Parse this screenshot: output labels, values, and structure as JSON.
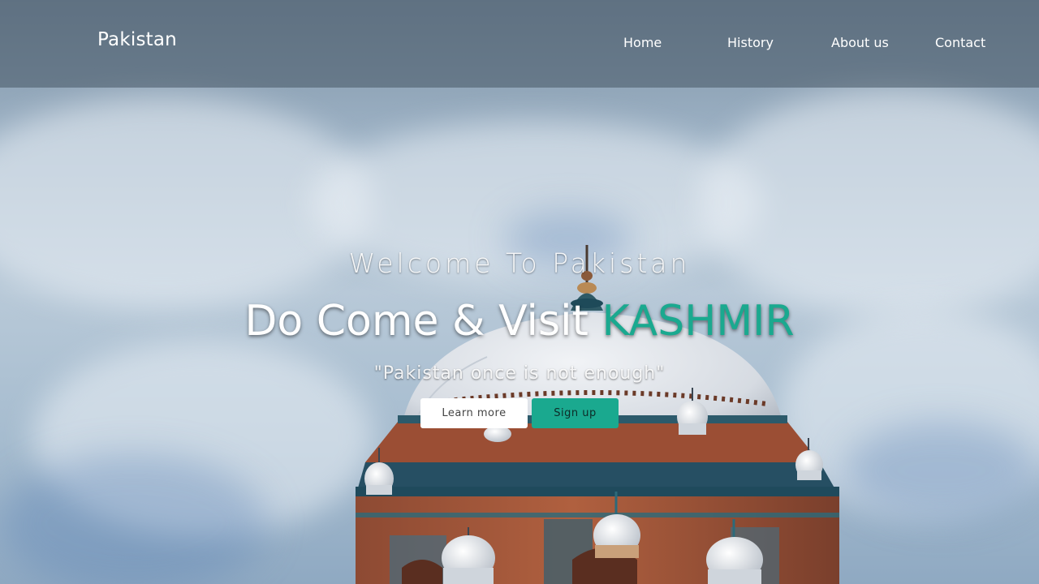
{
  "navbar": {
    "brand": "Pakistan",
    "links": [
      {
        "label": "Home"
      },
      {
        "label": "History"
      },
      {
        "label": "About us"
      },
      {
        "label": "Contact"
      }
    ]
  },
  "hero": {
    "subtitle": "Welcome To Pakistan",
    "title_prefix": "Do Come & Visit ",
    "title_accent": "KASHMIR",
    "quote": "\"Pakistan once is not enough\"",
    "learn_more_label": "Learn more",
    "sign_up_label": "Sign up"
  },
  "colors": {
    "accent": "#1aa98f",
    "navbar_bg": "rgba(70, 85, 100, 0.55)"
  },
  "background": {
    "image": "shrine-dome-photo"
  }
}
